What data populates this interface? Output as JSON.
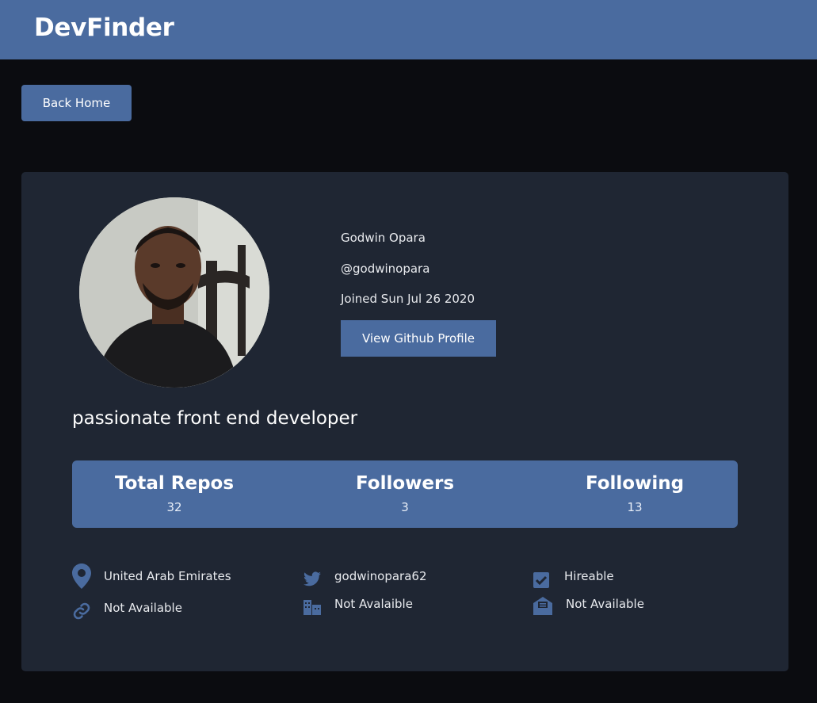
{
  "navbar": {
    "brand": "DevFinder"
  },
  "back_button": {
    "label": "Back Home"
  },
  "profile": {
    "name": "Godwin Opara",
    "login": "@godwinopara",
    "joined": "Joined Sun Jul 26 2020",
    "github_button": "View Github Profile",
    "bio": "passionate front end developer"
  },
  "stats": [
    {
      "label": "Total Repos",
      "value": "32"
    },
    {
      "label": "Followers",
      "value": "3"
    },
    {
      "label": "Following",
      "value": "13"
    }
  ],
  "details": {
    "location": "United Arab Emirates",
    "twitter": "godwinopara62",
    "hireable": "Hireable",
    "blog": "Not Available",
    "company": "Not Avalaible",
    "email": "Not Available"
  },
  "icons": {
    "location": "map-marker-icon",
    "twitter": "twitter-icon",
    "hireable": "check-square-icon",
    "blog": "link-icon",
    "company": "building-icon",
    "email": "envelope-open-icon"
  },
  "colors": {
    "accent": "#4a6b9f",
    "card": "#1f2633",
    "background": "#0b0c10"
  }
}
